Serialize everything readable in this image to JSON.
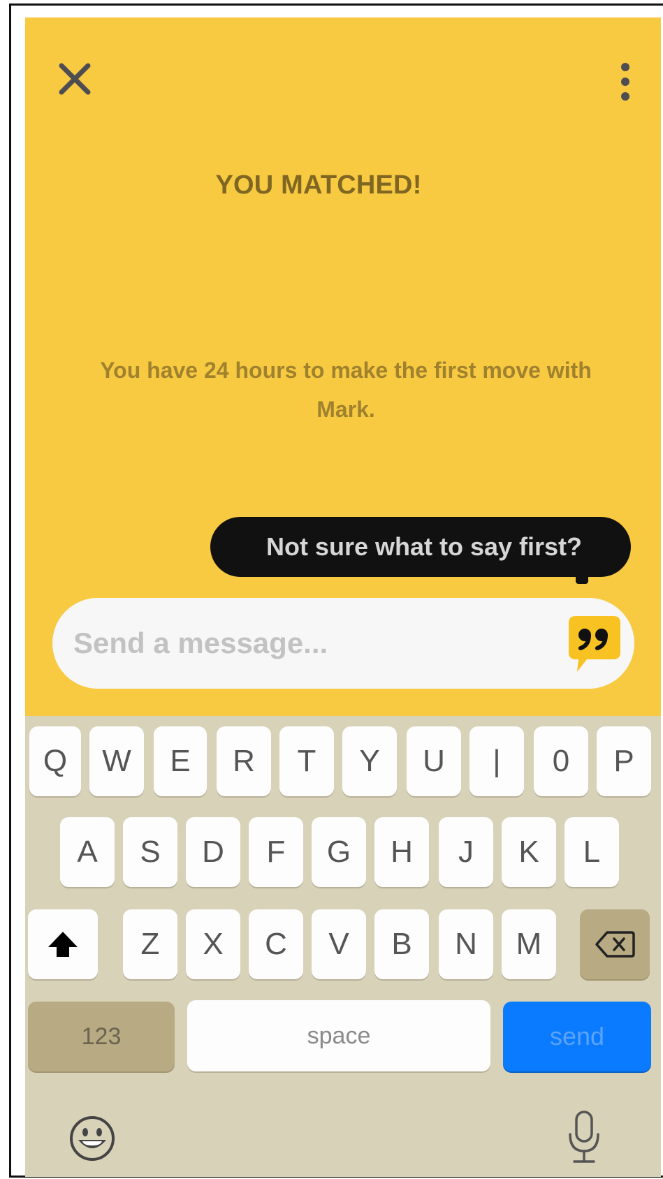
{
  "header": {
    "close_icon": "close-icon",
    "more_icon": "more-vertical-icon"
  },
  "match": {
    "title": "YOU MATCHED!",
    "subtitle_line1": "You have 24 hours to make the first move with",
    "subtitle_line2": "Mark."
  },
  "tooltip": {
    "text": "Not sure what to say first?"
  },
  "message": {
    "placeholder": "Send a message...",
    "value": "",
    "suggestion_icon": "quote-bubble-icon"
  },
  "keyboard": {
    "row1": [
      "Q",
      "W",
      "E",
      "R",
      "T",
      "Y",
      "U",
      "|",
      "0",
      "P"
    ],
    "row2": [
      "A",
      "S",
      "D",
      "F",
      "G",
      "H",
      "J",
      "K",
      "L"
    ],
    "row3": [
      "Z",
      "X",
      "C",
      "V",
      "B",
      "N",
      "M"
    ],
    "numbers_label": "123",
    "space_label": "space",
    "send_label": "send",
    "shift_icon": "shift-icon",
    "backspace_icon": "backspace-icon",
    "emoji_icon": "emoji-icon",
    "mic_icon": "microphone-icon"
  },
  "colors": {
    "background": "#f8ca42",
    "title": "#7f6622",
    "tooltip": "#111111",
    "keyboard": "#d8d2b8",
    "send": "#0a7bff"
  }
}
